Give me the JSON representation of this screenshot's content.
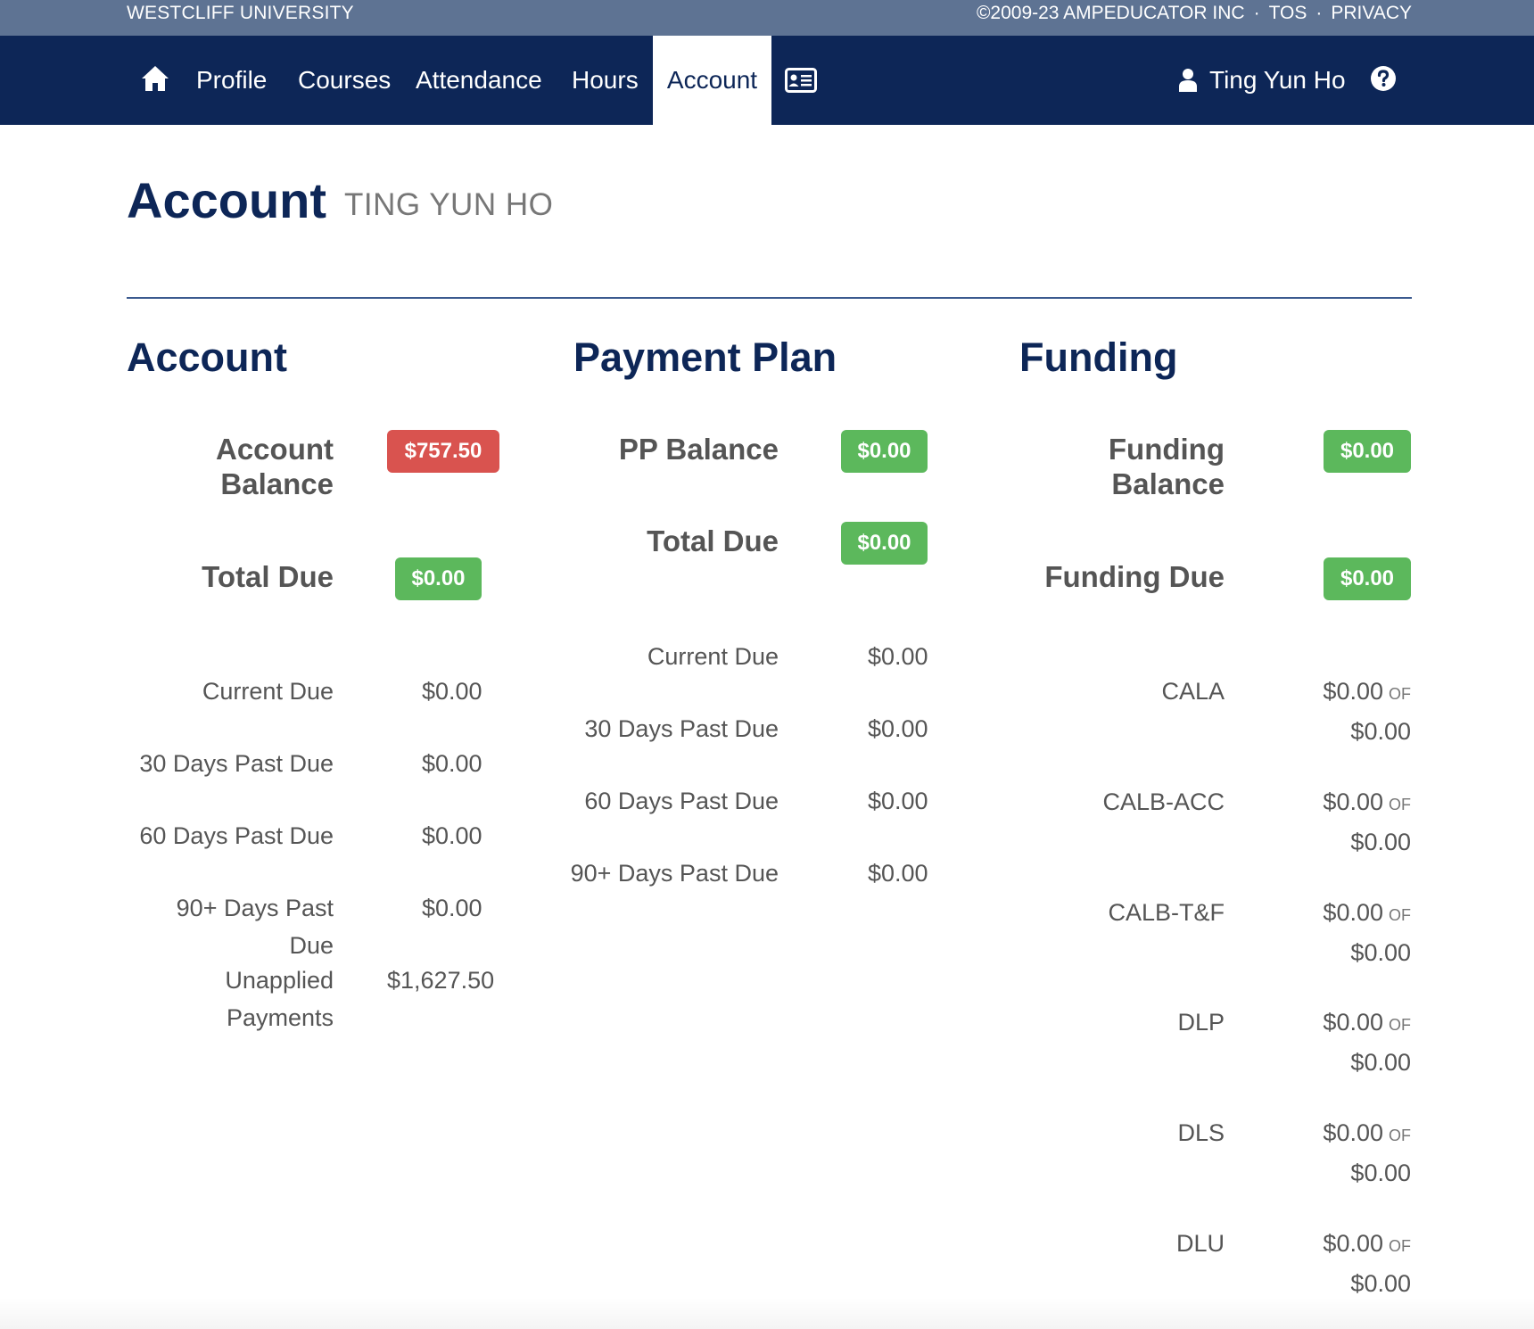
{
  "topstrip": {
    "school": "WESTCLIFF UNIVERSITY",
    "copyright": "©2009-23 AMPEDUCATOR INC",
    "tos": "TOS",
    "privacy": "PRIVACY",
    "separator": "·"
  },
  "nav": {
    "home_icon": "home-icon",
    "items": [
      "Profile",
      "Courses",
      "Attendance",
      "Hours",
      "Account"
    ],
    "active": "Account",
    "card_icon": "id-card-icon",
    "user_icon": "user-icon",
    "user_name": "Ting Yun Ho",
    "help_icon": "question-circle-icon",
    "colors": {
      "top_strip": "#5e7393",
      "navbar": "#0d2657"
    }
  },
  "header": {
    "title": "Account",
    "subtitle": "TING YUN HO"
  },
  "account": {
    "heading": "Account",
    "balance_label_1": "Account",
    "balance_label_2": "Balance",
    "balance_value": "$757.50",
    "total_due_label": "Total Due",
    "total_due_value": "$0.00",
    "rows": [
      {
        "label": "Current Due",
        "value": "$0.00"
      },
      {
        "label": "30 Days Past Due",
        "value": "$0.00"
      },
      {
        "label": "60 Days Past Due",
        "value": "$0.00"
      },
      {
        "label": "90+ Days Past Due",
        "value": "$0.00"
      }
    ],
    "unapplied_label_1": "Unapplied",
    "unapplied_label_2": "Payments",
    "unapplied_value": "$1,627.50"
  },
  "payment_plan": {
    "heading": "Payment Plan",
    "balance_label": "PP Balance",
    "balance_value": "$0.00",
    "total_due_label": "Total Due",
    "total_due_value": "$0.00",
    "rows": [
      {
        "label": "Current Due",
        "value": "$0.00"
      },
      {
        "label": "30 Days Past Due",
        "value": "$0.00"
      },
      {
        "label": "60 Days Past Due",
        "value": "$0.00"
      },
      {
        "label": "90+ Days Past Due",
        "value": "$0.00"
      }
    ]
  },
  "funding": {
    "heading": "Funding",
    "balance_label_1": "Funding",
    "balance_label_2": "Balance",
    "balance_value": "$0.00",
    "due_label": "Funding Due",
    "due_value": "$0.00",
    "of_label": "OF",
    "sources": [
      {
        "label": "CALA",
        "used": "$0.00",
        "total": "$0.00"
      },
      {
        "label": "CALB-ACC",
        "used": "$0.00",
        "total": "$0.00"
      },
      {
        "label": "CALB-T&F",
        "used": "$0.00",
        "total": "$0.00"
      },
      {
        "label": "DLP",
        "used": "$0.00",
        "total": "$0.00"
      },
      {
        "label": "DLS",
        "used": "$0.00",
        "total": "$0.00"
      },
      {
        "label": "DLU",
        "used": "$0.00",
        "total": "$0.00"
      }
    ]
  },
  "badge_colors": {
    "positive": "#5cb85c",
    "negative": "#d9534f"
  }
}
